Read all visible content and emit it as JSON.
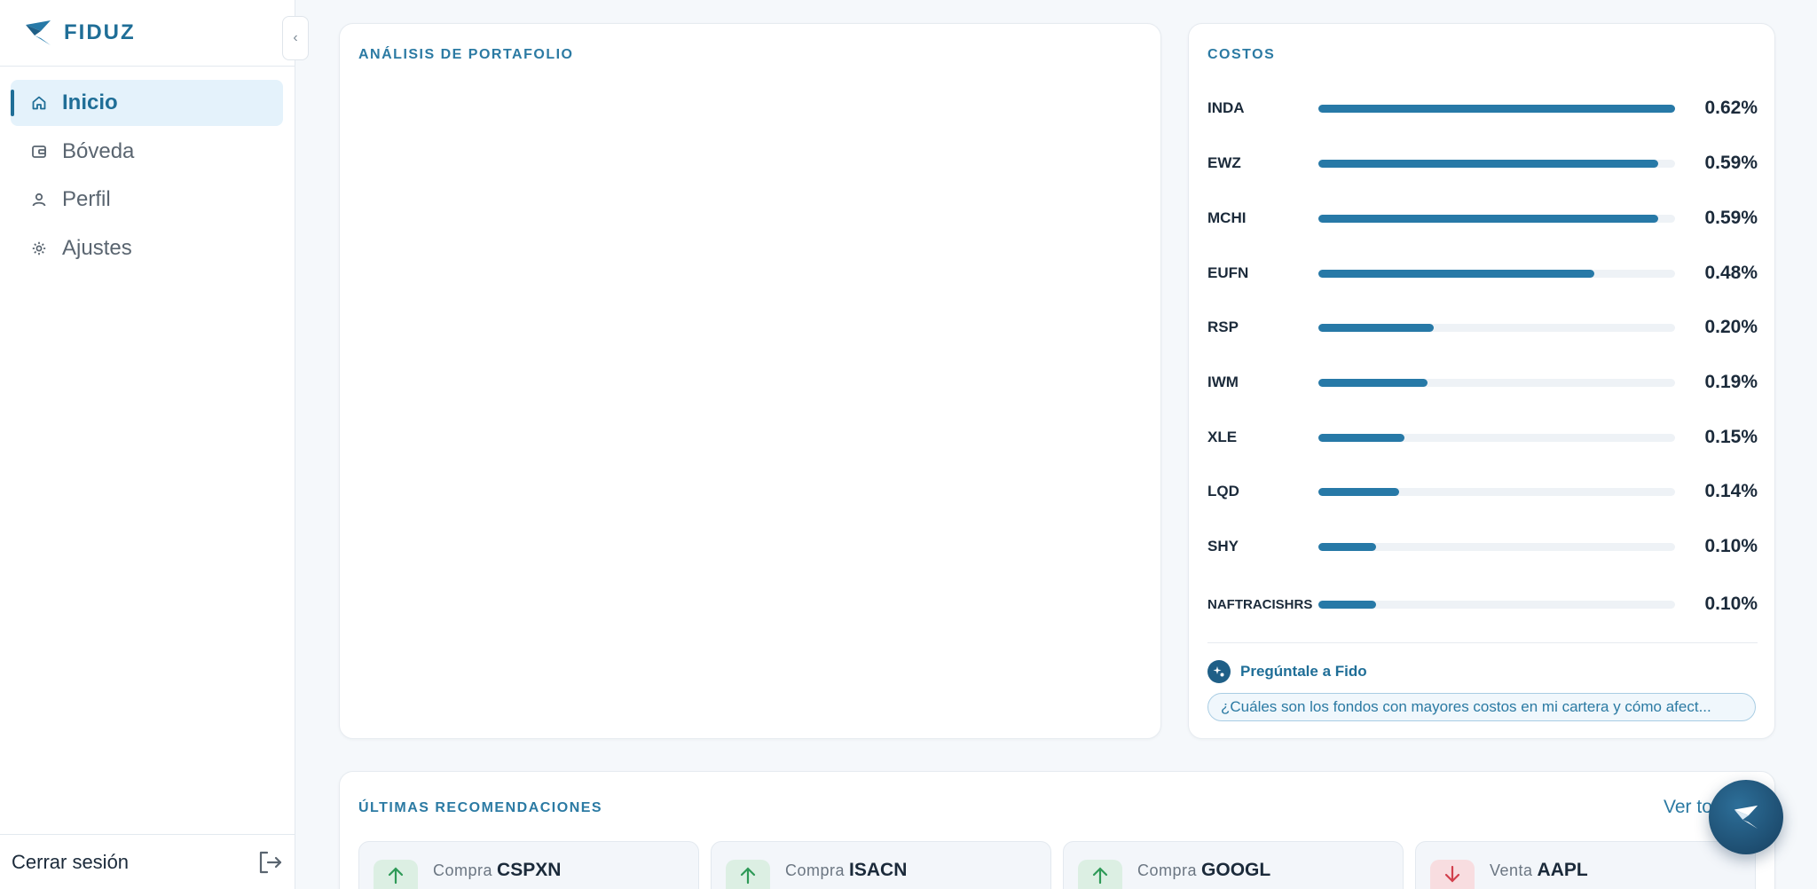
{
  "brand": {
    "name": "FIDUZ"
  },
  "sidebar": {
    "items": [
      {
        "label": "Inicio",
        "icon": "home-icon",
        "active": true
      },
      {
        "label": "Bóveda",
        "icon": "wallet-icon",
        "active": false
      },
      {
        "label": "Perfil",
        "icon": "user-icon",
        "active": false
      },
      {
        "label": "Ajustes",
        "icon": "gear-icon",
        "active": false
      }
    ],
    "logout_label": "Cerrar sesión"
  },
  "portfolio": {
    "title": "ANÁLISIS DE PORTAFOLIO"
  },
  "costs": {
    "title": "COSTOS",
    "items": [
      {
        "ticker": "INDA",
        "value": "0.62%",
        "fraction": 1.0
      },
      {
        "ticker": "EWZ",
        "value": "0.59%",
        "fraction": 0.952
      },
      {
        "ticker": "MCHI",
        "value": "0.59%",
        "fraction": 0.952
      },
      {
        "ticker": "EUFN",
        "value": "0.48%",
        "fraction": 0.774
      },
      {
        "ticker": "RSP",
        "value": "0.20%",
        "fraction": 0.323
      },
      {
        "ticker": "IWM",
        "value": "0.19%",
        "fraction": 0.306
      },
      {
        "ticker": "XLE",
        "value": "0.15%",
        "fraction": 0.242
      },
      {
        "ticker": "LQD",
        "value": "0.14%",
        "fraction": 0.226
      },
      {
        "ticker": "SHY",
        "value": "0.10%",
        "fraction": 0.161
      },
      {
        "ticker": "NAFTRACISHRS",
        "value": "0.10%",
        "fraction": 0.161
      }
    ],
    "ask_label": "Pregúntale a Fido",
    "suggestion": "¿Cuáles son los fondos con mayores costos en mi cartera y cómo afect..."
  },
  "recommendations": {
    "title": "ÚLTIMAS RECOMENDACIONES",
    "see_all": "Ver todas",
    "items": [
      {
        "action": "Compra",
        "ticker": "CSPXN",
        "direction": "up"
      },
      {
        "action": "Compra",
        "ticker": "ISACN",
        "direction": "up"
      },
      {
        "action": "Compra",
        "ticker": "GOOGL",
        "direction": "up"
      },
      {
        "action": "Venta",
        "ticker": "AAPL",
        "direction": "down"
      }
    ]
  },
  "colors": {
    "brand": "#1f6e97",
    "bar": "#2779a7",
    "buy": "#2e9a57",
    "sell": "#d2404d"
  }
}
